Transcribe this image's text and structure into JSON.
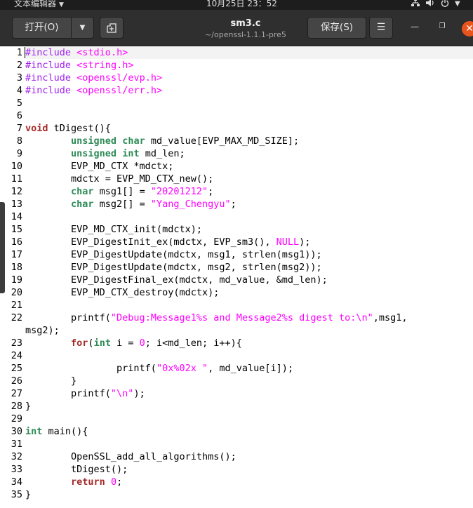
{
  "topbar": {
    "app_menu_label": "文本编辑器",
    "clock": "10月25日 23：52",
    "tray_icons": [
      "network-icon",
      "volume-icon",
      "power-icon"
    ]
  },
  "headerbar": {
    "open_label": "打开(O)",
    "save_label": "保存(S)",
    "title": "sm3.c",
    "path": "~/openssl-1.1.1-pre5"
  },
  "colors": {
    "preprocessor": "#a020f0",
    "string": "#ff00ff",
    "keyword": "#a52a2a",
    "type": "#2e8b57",
    "close_button": "#e9541d"
  },
  "editor": {
    "current_line": 1,
    "line_numbers": [
      "1",
      "2",
      "3",
      "4",
      "5",
      "6",
      "7",
      "8",
      "9",
      "10",
      "11",
      "12",
      "13",
      "14",
      "15",
      "16",
      "17",
      "18",
      "19",
      "20",
      "21",
      "22",
      "23",
      "24",
      "25",
      "26",
      "27",
      "28",
      "29",
      "30",
      "31",
      "32",
      "33",
      "34",
      "35"
    ],
    "lines": [
      "#include <stdio.h>",
      "#include <string.h>",
      "#include <openssl/evp.h>",
      "#include <openssl/err.h>",
      "",
      "",
      "void tDigest(){",
      "        unsigned char md_value[EVP_MAX_MD_SIZE];",
      "        unsigned int md_len;",
      "        EVP_MD_CTX *mdctx;",
      "        mdctx = EVP_MD_CTX_new();",
      "        char msg1[] = \"20201212\";",
      "        char msg2[] = \"Yang_Chengyu\";",
      "",
      "        EVP_MD_CTX_init(mdctx);",
      "        EVP_DigestInit_ex(mdctx, EVP_sm3(), NULL);",
      "        EVP_DigestUpdate(mdctx, msg1, strlen(msg1));",
      "        EVP_DigestUpdate(mdctx, msg2, strlen(msg2));",
      "        EVP_DigestFinal_ex(mdctx, md_value, &md_len);",
      "        EVP_MD_CTX_destroy(mdctx);",
      "",
      "        printf(\"Debug:Message1%s and Message2%s digest to:\\n\",msg1,",
      "msg2);",
      "        for(int i = 0; i<md_len; i++){",
      "",
      "                printf(\"0x%02x \", md_value[i]);",
      "        }",
      "        printf(\"\\n\");",
      "}",
      "",
      "int main(){",
      "",
      "        OpenSSL_add_all_algorithms();",
      "        tDigest();",
      "        return 0;",
      "}"
    ],
    "visual_to_line": [
      1,
      2,
      3,
      4,
      5,
      6,
      7,
      8,
      9,
      10,
      11,
      12,
      13,
      14,
      15,
      16,
      17,
      18,
      19,
      20,
      21,
      22,
      0,
      23,
      24,
      25,
      26,
      27,
      28,
      29,
      30,
      31,
      32,
      33,
      34,
      35
    ]
  }
}
